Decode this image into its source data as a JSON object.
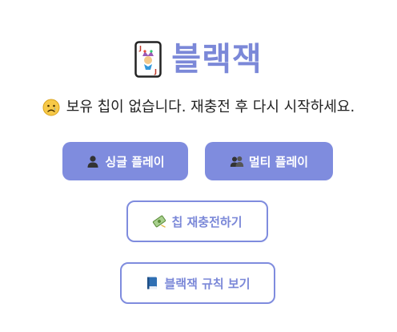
{
  "header": {
    "title": "블랙잭",
    "card_icon": "joker-card-icon"
  },
  "status": {
    "icon": "sad-face-icon",
    "message": "보유 칩이 없습니다. 재충전 후 다시 시작하세요."
  },
  "buttons": {
    "single_play": {
      "icon": "person-icon",
      "label": "싱글 플레이"
    },
    "multi_play": {
      "icon": "people-icon",
      "label": "멀티 플레이"
    },
    "recharge": {
      "icon": "money-icon",
      "label": "칩 재충전하기"
    },
    "rules": {
      "icon": "book-icon",
      "label": "블랙잭 규칙 보기"
    }
  },
  "colors": {
    "accent": "#7f8cde",
    "title": "#7b88d8",
    "text": "#222222",
    "background": "#ffffff"
  }
}
